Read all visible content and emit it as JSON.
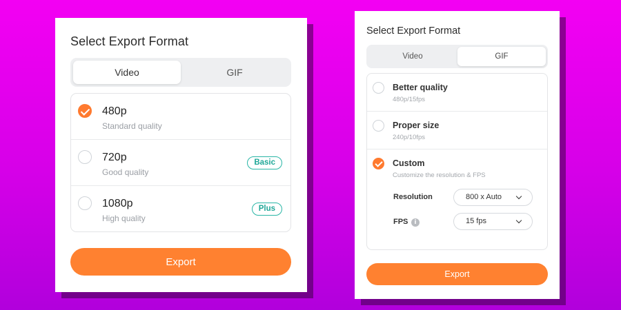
{
  "colors": {
    "background": "#e800f0",
    "accent": "#ff8130",
    "badge": "#20a898",
    "card": "#ffffff"
  },
  "left_panel": {
    "title": "Select Export Format",
    "tabs": [
      {
        "label": "Video",
        "selected": true
      },
      {
        "label": "GIF",
        "selected": false
      }
    ],
    "options": [
      {
        "name": "480p",
        "description": "Standard quality",
        "selected": true,
        "badge": ""
      },
      {
        "name": "720p",
        "description": "Good quality",
        "selected": false,
        "badge": "Basic"
      },
      {
        "name": "1080p",
        "description": "High quality",
        "selected": false,
        "badge": "Plus"
      }
    ],
    "export_label": "Export"
  },
  "right_panel": {
    "title": "Select Export Format",
    "tabs": [
      {
        "label": "Video",
        "selected": false
      },
      {
        "label": "GIF",
        "selected": true
      }
    ],
    "options": [
      {
        "name": "Better quality",
        "description": "480p/15fps",
        "selected": false
      },
      {
        "name": "Proper size",
        "description": "240p/10fps",
        "selected": false
      },
      {
        "name": "Custom",
        "description": "Customize the resolution & FPS",
        "selected": true
      }
    ],
    "resolution": {
      "label": "Resolution",
      "value": "800 x Auto"
    },
    "fps": {
      "label": "FPS",
      "info_icon": "info-icon",
      "info_glyph": "i",
      "value": "15 fps"
    },
    "export_label": "Export"
  }
}
